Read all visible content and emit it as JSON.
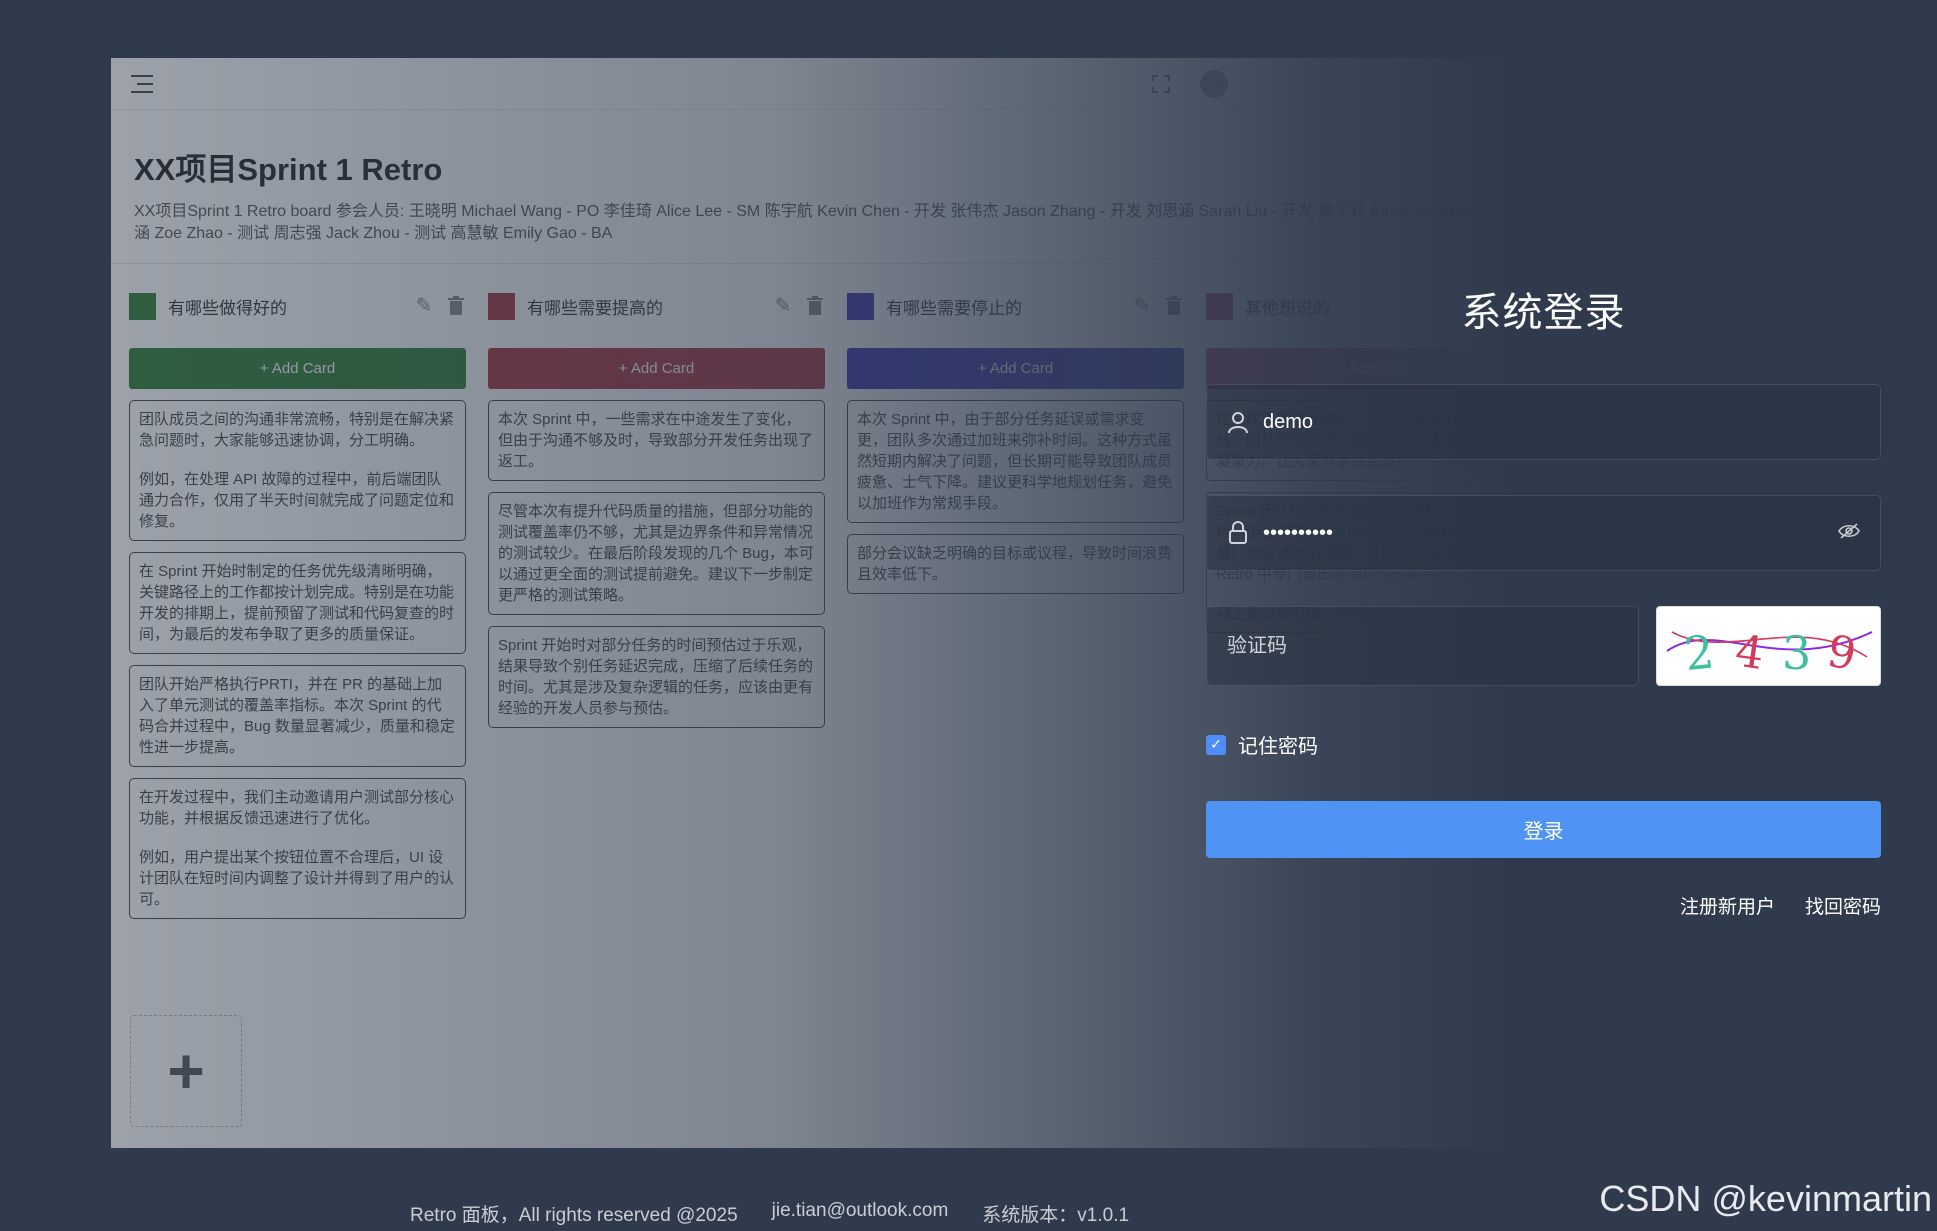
{
  "board": {
    "title": "XX项目Sprint 1 Retro",
    "description": "XX项目Sprint 1 Retro board 参会人员: 王晓明 Michael Wang - PO 李佳琦 Alice Lee - SM 陈宇航 Kevin Chen - 开发 张伟杰 Jason Zhang - 开发 刘思涵 Sarah Liu - 开发 黄子轩 Ethan Huang - 开发 赵子涵 Zoe Zhao - 测试 周志强 Jack Zhou - 测试 高慧敏 Emily Gao - BA",
    "add_column_symbol": "+",
    "columns": [
      {
        "title": "有哪些做得好的",
        "color": "#2f7d32",
        "add_label": "+ Add Card",
        "cards": [
          [
            "团队成员之间的沟通非常流畅，特别是在解决紧急问题时，大家能够迅速协调，分工明确。",
            "例如，在处理 API 故障的过程中，前后端团队通力合作，仅用了半天时间就完成了问题定位和修复。"
          ],
          [
            "在 Sprint 开始时制定的任务优先级清晰明确，关键路径上的工作都按计划完成。特别是在功能开发的排期上，提前预留了测试和代码复查的时间，为最后的发布争取了更多的质量保证。"
          ],
          [
            "团队开始严格执行PRTI，并在 PR 的基础上加入了单元测试的覆盖率指标。本次 Sprint 的代码合并过程中，Bug 数量显著减少，质量和稳定性进一步提高。"
          ],
          [
            "在开发过程中，我们主动邀请用户测试部分核心功能，并根据反馈迅速进行了优化。",
            "例如，用户提出某个按钮位置不合理后，UI 设计团队在短时间内调整了设计并得到了用户的认可。"
          ]
        ]
      },
      {
        "title": "有哪些需要提高的",
        "color": "#a8323f",
        "add_label": "+ Add Card",
        "cards": [
          [
            "本次 Sprint 中，一些需求在中途发生了变化，但由于沟通不够及时，导致部分开发任务出现了返工。"
          ],
          [
            "尽管本次有提升代码质量的措施，但部分功能的测试覆盖率仍不够，尤其是边界条件和异常情况的测试较少。在最后阶段发现的几个 Bug，本可以通过更全面的测试提前避免。建议下一步制定更严格的测试策略。"
          ],
          [
            "Sprint 开始时对部分任务的时间预估过于乐观，结果导致个别任务延迟完成，压缩了后续任务的时间。尤其是涉及复杂逻辑的任务，应该由更有经验的开发人员参与预估。"
          ]
        ]
      },
      {
        "title": "有哪些需要停止的",
        "color": "#3a33b5",
        "add_label": "+ Add Card",
        "cards": [
          [
            "本次 Sprint 中，由于部分任务延误或需求变更，团队多次通过加班来弥补时间。这种方式虽然短期内解决了问题，但长期可能导致团队成员疲惫、士气下降。建议更科学地规划任务，避免以加班作为常规手段。"
          ],
          [
            "部分会议缺乏明确的目标或议程，导致时间浪费且效率低下。"
          ]
        ]
      },
      {
        "title": "其他想说的",
        "color": "#c0396a",
        "add_label": "+ Add Card",
        "cards": [
          [
            "在完成重要里程碑时，比如完成某个版本的上线，团队可以组织小规模的庆祝活动，增强团队凝聚力。让大家分享会或轻松的休息时光。"
          ],
          [
            "Sprint 团队讨论中在这段时间发起了技术专项目标，但长期规划（如技术架构优化和代码质量扩展）也应该定期回顾，可以考虑在每个 Sprint Retro 中专门留出时间讨论长期目标的进展。",
            "马上要过春节啦，很开心"
          ]
        ]
      }
    ]
  },
  "login": {
    "title": "系统登录",
    "username_value": "demo",
    "password_value": "••••••••••",
    "captcha_placeholder": "验证码",
    "captcha_text": "2439",
    "remember_label": "记住密码",
    "submit_label": "登录",
    "register_link": "注册新用户",
    "recover_link": "找回密码"
  },
  "footer": {
    "copyright": "Retro 面板，All rights reserved @2025",
    "email": "jie.tian@outlook.com",
    "version": "系统版本：v1.0.1"
  },
  "watermark": "CSDN @kevinmartin"
}
